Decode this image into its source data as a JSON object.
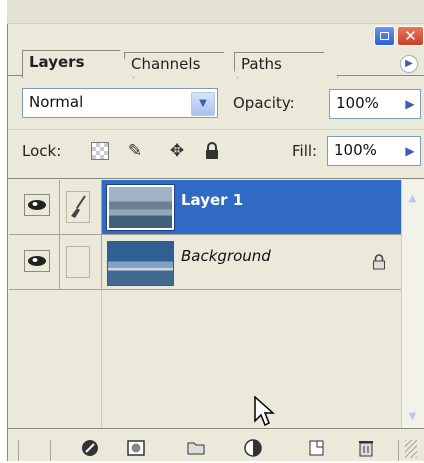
{
  "tabs": [
    {
      "label": "Layers",
      "active": true
    },
    {
      "label": "Channels",
      "active": false
    },
    {
      "label": "Paths",
      "active": false
    }
  ],
  "blend_mode": {
    "value": "Normal"
  },
  "opacity": {
    "label": "Opacity:",
    "value": "100%"
  },
  "lock": {
    "label": "Lock:"
  },
  "fill": {
    "label": "Fill:",
    "value": "100%"
  },
  "layers": [
    {
      "name": "Layer 1",
      "selected": true,
      "visible": true,
      "locked": false
    },
    {
      "name": "Background",
      "selected": false,
      "visible": true,
      "locked": true
    }
  ],
  "colors": {
    "selection": "#316ac5",
    "panel": "#ebe9da",
    "close": "#c84026"
  },
  "icons": [
    "link-layers-icon",
    "add-layer-style-icon",
    "add-mask-icon",
    "new-group-icon",
    "new-adjustment-layer-icon",
    "new-layer-icon",
    "delete-layer-icon"
  ]
}
